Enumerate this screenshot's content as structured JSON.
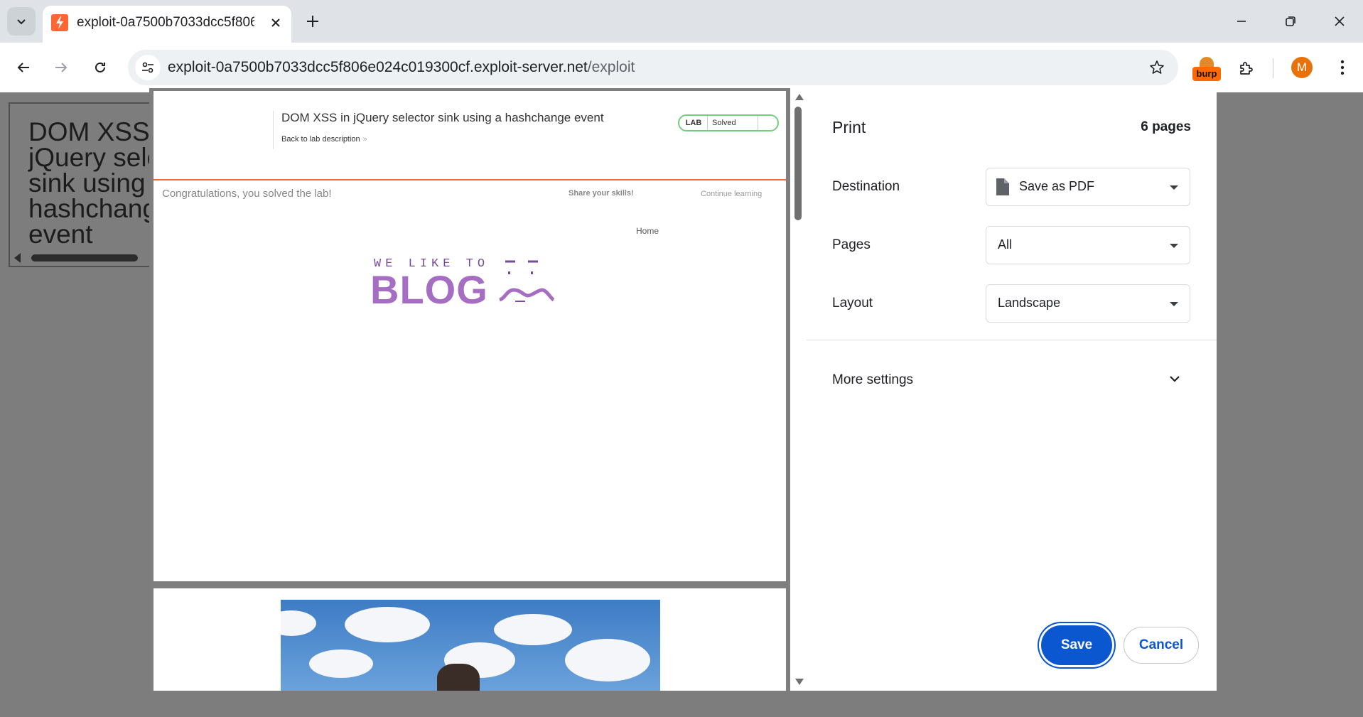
{
  "browser": {
    "tab_title": "exploit-0a7500b7033dcc5f806e",
    "url_host": "exploit-0a7500b7033dcc5f806e024c019300cf.exploit-server.net",
    "url_path": "/exploit",
    "burp_label": "burp",
    "avatar_letter": "M"
  },
  "background_page": {
    "heading_lines": [
      "DOM XSS",
      "jQuery sele",
      "sink using",
      "hashchang",
      "event"
    ]
  },
  "preview": {
    "page1": {
      "lab_title": "DOM XSS in jQuery selector sink using a hashchange event",
      "back_link": "Back to lab description",
      "back_arrow": "»",
      "lab_badge": "LAB",
      "lab_status": "Solved",
      "congrats": "Congratulations, you solved the lab!",
      "share": "Share your skills!",
      "continue": "Continue learning",
      "home": "Home",
      "logo_top": "WE LIKE TO",
      "logo_main": "BLOG"
    }
  },
  "print": {
    "title": "Print",
    "pages_count": "6 pages",
    "destination_label": "Destination",
    "destination_value": "Save as PDF",
    "pages_label": "Pages",
    "pages_value": "All",
    "layout_label": "Layout",
    "layout_value": "Landscape",
    "more_settings": "More settings",
    "save": "Save",
    "cancel": "Cancel"
  },
  "colors": {
    "accent_blue": "#0b57d0",
    "lab_orange": "#ff6633",
    "logo_purple": "#a66ec3",
    "solved_green": "#70d080"
  }
}
